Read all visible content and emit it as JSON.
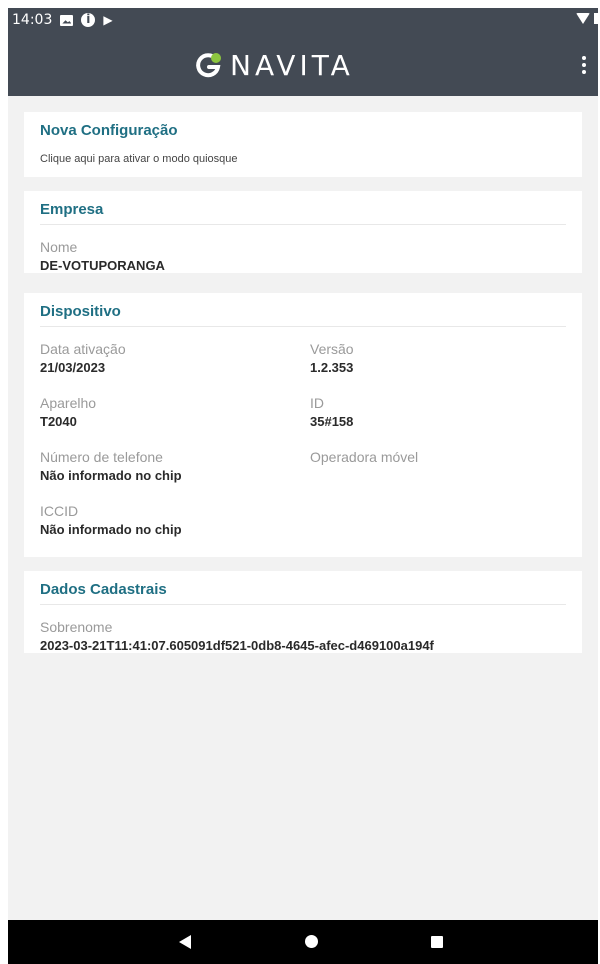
{
  "status_bar": {
    "time": "14:03",
    "icons": [
      "image-icon",
      "info-icon",
      "play-store-icon",
      "wifi-icon",
      "battery-icon"
    ]
  },
  "app_bar": {
    "logo_text": "NAVITA",
    "menu_icon": "more-vertical-icon",
    "brand_color": "#8dc63f",
    "bar_color": "#434a54"
  },
  "config_card": {
    "title": "Nova Configuração",
    "subtitle": "Clique aqui para ativar o modo quiosque"
  },
  "empresa": {
    "title": "Empresa",
    "nome_label": "Nome",
    "nome_value": "DE-VOTUPORANGA"
  },
  "dispositivo": {
    "title": "Dispositivo",
    "data_ativacao_label": "Data ativação",
    "data_ativacao_value": "21/03/2023",
    "versao_label": "Versão",
    "versao_value": "1.2.353",
    "aparelho_label": "Aparelho",
    "aparelho_value": "T2040",
    "id_label": "ID",
    "id_value": "35#158",
    "telefone_label": "Número de telefone",
    "telefone_value": "Não informado no chip",
    "operadora_label": "Operadora móvel",
    "iccid_label": "ICCID",
    "iccid_value": "Não informado no chip"
  },
  "dados_cadastrais": {
    "title": "Dados Cadastrais",
    "sobrenome_label": "Sobrenome",
    "sobrenome_value": "2023-03-21T11:41:07.605091df521-0db8-4645-afec-d469100a194f"
  },
  "nav_bar": {
    "icons": [
      "back-icon",
      "home-icon",
      "recents-icon"
    ]
  },
  "colors": {
    "accent": "#1f6f83",
    "background": "#f2f2f2"
  }
}
